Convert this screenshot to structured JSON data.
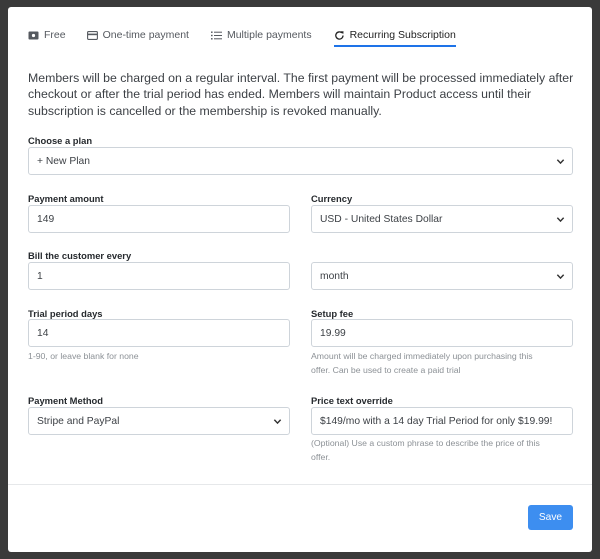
{
  "tabs": [
    {
      "label": "Free",
      "icon": "ticket-icon"
    },
    {
      "label": "One-time payment",
      "icon": "credit-card-icon"
    },
    {
      "label": "Multiple payments",
      "icon": "list-icon"
    },
    {
      "label": "Recurring Subscription",
      "icon": "refresh-icon",
      "active": true
    }
  ],
  "description": "Members will be charged on a regular interval. The first payment will be processed immediately after checkout or after the trial period has ended. Members will maintain Product access until their subscription is cancelled or the membership is revoked manually.",
  "plan": {
    "label": "Choose a plan",
    "value": "+ New Plan"
  },
  "payment_amount": {
    "label": "Payment amount",
    "value": "149"
  },
  "currency": {
    "label": "Currency",
    "value": "USD - United States Dollar"
  },
  "bill_every": {
    "label": "Bill the customer every",
    "value": "1",
    "unit": "month"
  },
  "trial": {
    "label": "Trial period days",
    "value": "14",
    "help": "1-90, or leave blank for none"
  },
  "setup_fee": {
    "label": "Setup fee",
    "value": "19.99",
    "help_line1": "Amount will be charged immediately upon purchasing this",
    "help_line2": "offer. Can be used to create a paid trial"
  },
  "payment_method": {
    "label": "Payment Method",
    "value": "Stripe and PayPal"
  },
  "price_override": {
    "label": "Price text override",
    "value": "$149/mo with a 14 day Trial Period for only $19.99!",
    "help_line1": "(Optional) Use a custom phrase to describe the price of this",
    "help_line2": "offer."
  },
  "save_label": "Save",
  "colors": {
    "accent": "#1e73e8",
    "button": "#3d8ef0"
  }
}
